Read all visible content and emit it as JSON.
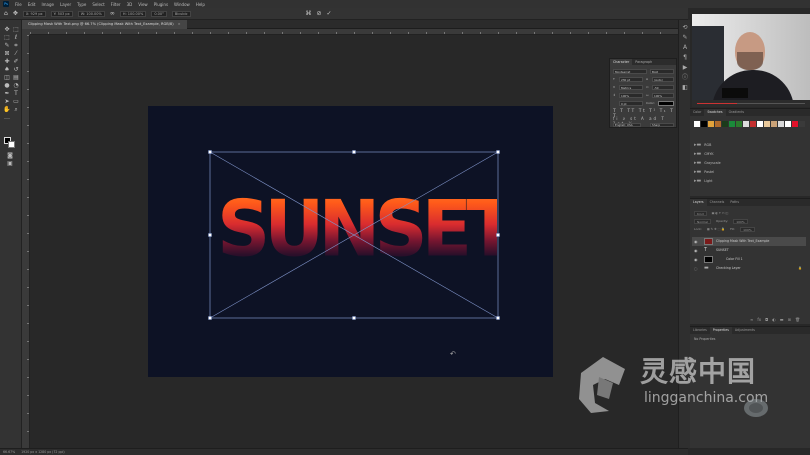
{
  "menubar": {
    "app_logo": "Ps",
    "items": [
      "File",
      "Edit",
      "Image",
      "Layer",
      "Type",
      "Select",
      "Filter",
      "3D",
      "View",
      "Plugins",
      "Window",
      "Help"
    ]
  },
  "options": {
    "x": "X: 929 px",
    "y": "Y: 503 px",
    "w": "W: 100.00%",
    "h": "H: 100.00%",
    "angle": "0.00°",
    "interp": "Bicubic"
  },
  "document": {
    "tab_title": "Clipping Mask With Text.png @ 66.7% (Clipping Mask With Text_Example, RGB/8)",
    "tab_close": "×",
    "sunset_text": "SUNSET",
    "colors": {
      "canvas": "#0d1225",
      "handles": "#7f93c9",
      "fill_top": "#ff8a2a",
      "fill_mid": "#d92c2f",
      "fill_bottom": "#101022"
    }
  },
  "status": {
    "zoom": "66.67%",
    "doc_size": "1920 px x 1280 px (72 ppi)"
  },
  "character_panel": {
    "tabs": [
      "Character",
      "Paragraph"
    ],
    "active_tab": "Character",
    "font_family": "Montserrat",
    "font_style": "Bold",
    "font_size": "230 pt",
    "leading": "(Auto)",
    "kerning": "Metrics",
    "tracking": "-50",
    "vert_scale": "100%",
    "horiz_scale": "100%",
    "baseline": "0 pt",
    "color_label": "Color:",
    "language": "English: USA",
    "antialias": "Sharp"
  },
  "swatches_panel": {
    "tabs": [
      "Color",
      "Swatches",
      "Gradients"
    ],
    "active_tab": "Swatches",
    "swatch_colors": [
      "#ffffff",
      "#000000",
      "#e2a33c",
      "#b06a2b",
      "#1b3b1b",
      "#1a8a3a",
      "#2c7a2c",
      "#dddddd",
      "#c43030",
      "#ffffff",
      "#e8c89a",
      "#caa277",
      "#d8d8d8",
      "#ffffff",
      "#e2112a",
      "#3a3a3a"
    ],
    "folders": [
      "RGB",
      "CMYK",
      "Grayscale",
      "Pastel",
      "Light"
    ]
  },
  "layers_panel": {
    "tabs": [
      "Layers",
      "Channels",
      "Paths"
    ],
    "active_tab": "Layers",
    "kind_label": "Kind",
    "blend_mode": "Normal",
    "opacity_label": "Opacity:",
    "opacity": "100%",
    "lock_label": "Lock:",
    "fill_label": "Fill:",
    "fill": "100%",
    "layers": [
      {
        "name": "Clipping Mask With Text_Example",
        "selected": true,
        "thumb_color": "#7a1a1a"
      },
      {
        "name": "SUNSET",
        "selected": false,
        "thumb_color": "#333333"
      },
      {
        "name": "Color Fill 1",
        "selected": false,
        "thumb_color": "#000000"
      },
      {
        "name": "Checking Layer",
        "selected": false,
        "thumb_color": "#444444"
      }
    ]
  },
  "properties_panel": {
    "tabs": [
      "Libraries",
      "Properties",
      "Adjustments"
    ],
    "active_tab": "Properties",
    "empty_text": "No Properties"
  },
  "watermark": {
    "cn_text": "灵感中国",
    "url_text": "lingganchina.com"
  }
}
